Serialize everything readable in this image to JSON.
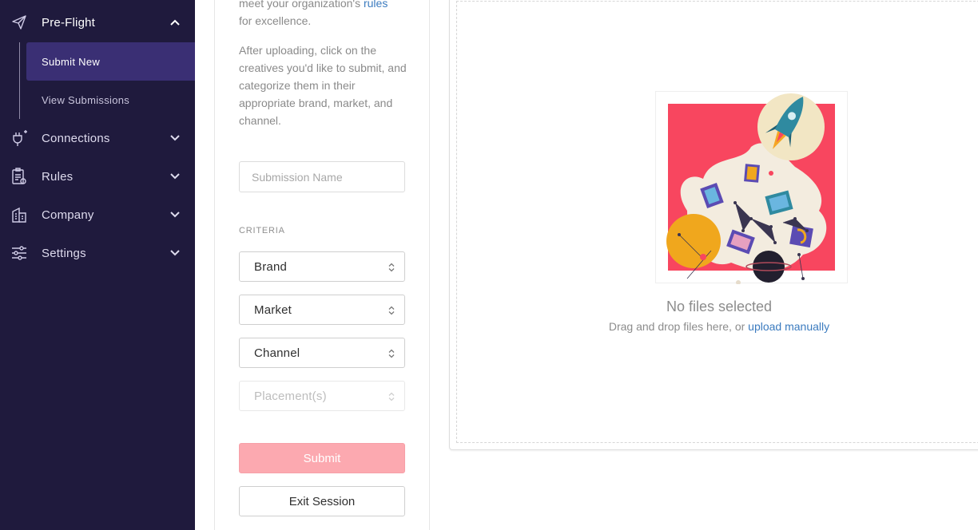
{
  "sidebar": {
    "items": [
      {
        "label": "Pre-Flight",
        "icon": "paper-plane-icon",
        "expanded": true
      },
      {
        "label": "Connections",
        "icon": "plug-icon"
      },
      {
        "label": "Rules",
        "icon": "checklist-icon"
      },
      {
        "label": "Company",
        "icon": "building-icon"
      },
      {
        "label": "Settings",
        "icon": "sliders-icon"
      }
    ],
    "subitems": [
      {
        "label": "Submit New",
        "selected": true
      },
      {
        "label": "View Submissions"
      }
    ],
    "colors": {
      "background": "#1f1a3d",
      "selected": "#3a2f74"
    }
  },
  "form": {
    "intro_line1": "meet your organization's ",
    "intro_link": "rules",
    "intro_line2": "for excellence.",
    "instructions": "After uploading, click on the creatives you'd like to submit, and categorize them in their appropriate brand, market, and channel.",
    "submission_name_placeholder": "Submission Name",
    "criteria_heading": "CRITERIA",
    "selects": {
      "brand": "Brand",
      "market": "Market",
      "channel": "Channel",
      "placement": "Placement(s)"
    },
    "submit_label": "Submit",
    "exit_label": "Exit Session",
    "colors": {
      "submit": "#fca9b0",
      "link": "#3b7bbf"
    }
  },
  "dropzone": {
    "title": "No files selected",
    "subtitle": "Drag and drop files here, or ",
    "upload_link": "upload manually"
  }
}
